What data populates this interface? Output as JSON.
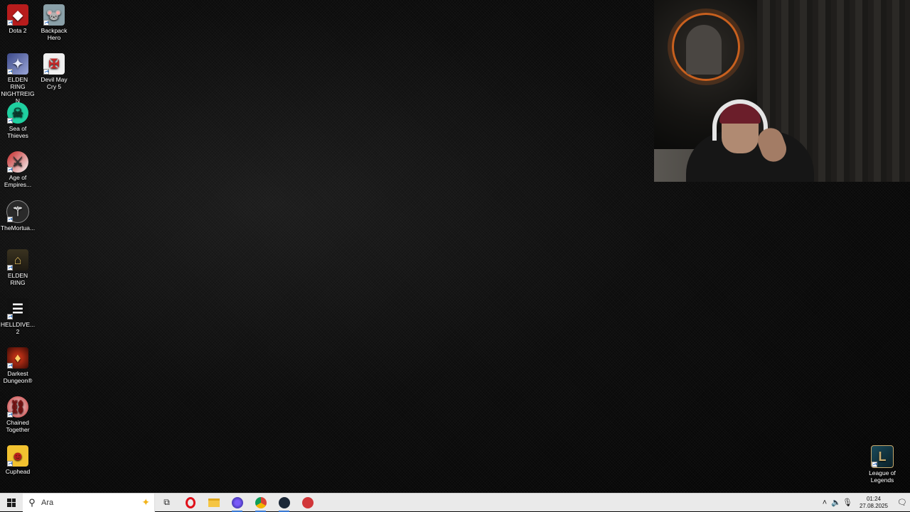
{
  "desktop": {
    "icons": [
      {
        "label": "Dota 2",
        "icon": "dota2-icon"
      },
      {
        "label": "Backpack Hero",
        "icon": "backpack-hero-icon"
      },
      {
        "label": "ELDEN RING NIGHTREIGN",
        "icon": "elden-ring-nightreign-icon"
      },
      {
        "label": "Devil May Cry 5",
        "icon": "devil-may-cry-5-icon"
      },
      {
        "label": "Sea of Thieves",
        "icon": "sea-of-thieves-icon"
      },
      {
        "label": "Age of Empires...",
        "icon": "age-of-empires-icon"
      },
      {
        "label": "TheMortua...",
        "icon": "the-mortuary-icon"
      },
      {
        "label": "ELDEN RING",
        "icon": "elden-ring-icon"
      },
      {
        "label": "HELLDIVE... 2",
        "icon": "helldivers-2-icon"
      },
      {
        "label": "Darkest Dungeon®",
        "icon": "darkest-dungeon-icon"
      },
      {
        "label": "Chained Together",
        "icon": "chained-together-icon"
      },
      {
        "label": "Cuphead",
        "icon": "cuphead-icon"
      },
      {
        "label": "League of Legends",
        "icon": "league-of-legends-icon"
      }
    ]
  },
  "taskbar": {
    "search_placeholder": "Ara",
    "apps": [
      "task-view-icon",
      "opera-icon",
      "file-explorer-icon",
      "gamebar-icon",
      "chrome-icon",
      "steam-icon",
      "riot-client-icon"
    ],
    "clock_time": "01:24",
    "clock_date": "27.08.2025"
  },
  "colors": {
    "taskbar_bg": "#eaeaea",
    "active_indicator": "#3a7bd5"
  }
}
